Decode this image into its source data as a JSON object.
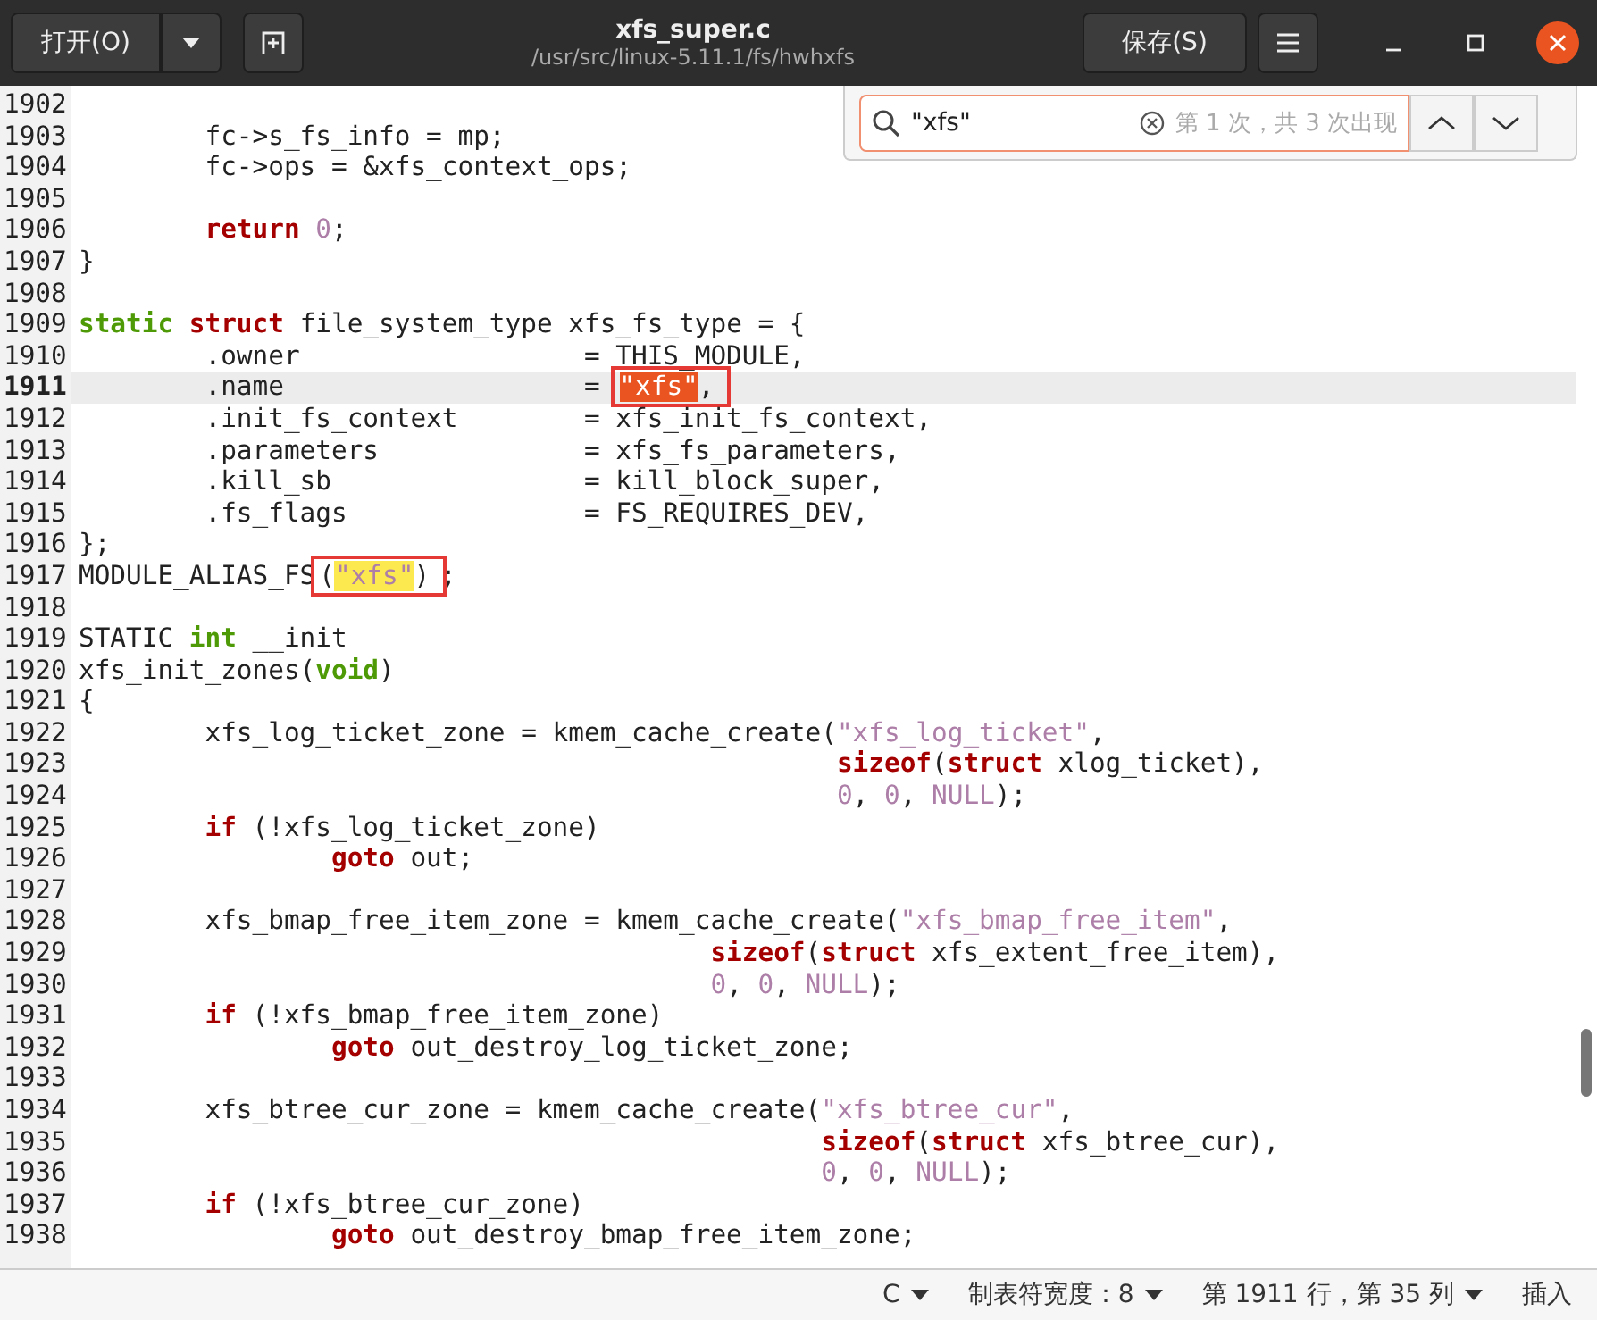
{
  "header": {
    "open_button": "打开(O)",
    "title": "xfs_super.c",
    "subtitle": "/usr/src/linux-5.11.1/fs/hwhxfs",
    "save_button": "保存(S)"
  },
  "search": {
    "value": "\"xfs\"",
    "result": "第 1 次，共 3 次出现"
  },
  "editor": {
    "lines": [
      {
        "number": "1902",
        "current": false
      },
      {
        "number": "1903",
        "current": false,
        "parts": [
          {
            "text": "        fc->s_fs_info = mp;",
            "kind": "plain"
          }
        ]
      },
      {
        "number": "1904",
        "current": false,
        "parts": [
          {
            "text": "        fc->ops = &xfs_context_ops;",
            "kind": "plain"
          }
        ]
      },
      {
        "number": "1905",
        "current": false
      },
      {
        "number": "1906",
        "current": false,
        "parts": [
          {
            "text": "        return",
            "kind": "keyword"
          },
          {
            "text": " 0",
            "kind": "number"
          },
          {
            "text": ";",
            "kind": "plain"
          }
        ]
      },
      {
        "number": "1907",
        "current": false,
        "parts": [
          {
            "text": "}",
            "kind": "plain"
          }
        ]
      },
      {
        "number": "1908",
        "current": false
      },
      {
        "number": "1909",
        "current": false,
        "parts": [
          {
            "text": "static",
            "kind": "type"
          },
          {
            "text": " struct",
            "kind": "keyword"
          },
          {
            "text": " file_system_type xfs_fs_type = {",
            "kind": "plain"
          }
        ]
      },
      {
        "number": "1910",
        "current": false,
        "parts": [
          {
            "text": "        .owner                  = THIS_MODULE,",
            "kind": "plain"
          }
        ]
      },
      {
        "number": "1911",
        "current": true,
        "parts": [
          {
            "text": "        .name                   = ",
            "kind": "plain"
          },
          {
            "boxed": true,
            "parts": [
              {
                "text": "\"xfs\"",
                "kind": "match",
                "current": true
              },
              {
                "text": ",",
                "kind": "plain"
              }
            ]
          }
        ]
      },
      {
        "number": "1912",
        "current": false,
        "parts": [
          {
            "text": "        .init_fs_context        = xfs_init_fs_context,",
            "kind": "plain"
          }
        ]
      },
      {
        "number": "1913",
        "current": false,
        "parts": [
          {
            "text": "        .parameters             = xfs_fs_parameters,",
            "kind": "plain"
          }
        ]
      },
      {
        "number": "1914",
        "current": false,
        "parts": [
          {
            "text": "        .kill_sb                = kill_block_super,",
            "kind": "plain"
          }
        ]
      },
      {
        "number": "1915",
        "current": false,
        "parts": [
          {
            "text": "        .fs_flags               = FS_REQUIRES_DEV,",
            "kind": "plain"
          }
        ]
      },
      {
        "number": "1916",
        "current": false,
        "parts": [
          {
            "text": "};",
            "kind": "plain"
          }
        ]
      },
      {
        "number": "1917",
        "current": false,
        "parts": [
          {
            "text": "MODULE_ALIAS_FS",
            "kind": "plain"
          },
          {
            "boxed": true,
            "parts": [
              {
                "text": "(",
                "kind": "plain"
              },
              {
                "text": "\"xfs\"",
                "kind": "match",
                "current": false
              },
              {
                "text": ")",
                "kind": "plain"
              }
            ]
          },
          {
            "text": ";",
            "kind": "plain"
          }
        ]
      },
      {
        "number": "1918",
        "current": false
      },
      {
        "number": "1919",
        "current": false,
        "parts": [
          {
            "text": "STATIC ",
            "kind": "plain"
          },
          {
            "text": "int",
            "kind": "type"
          },
          {
            "text": " __init",
            "kind": "plain"
          }
        ]
      },
      {
        "number": "1920",
        "current": false,
        "parts": [
          {
            "text": "xfs_init_zones(",
            "kind": "plain"
          },
          {
            "text": "void",
            "kind": "type"
          },
          {
            "text": ")",
            "kind": "plain"
          }
        ]
      },
      {
        "number": "1921",
        "current": false,
        "parts": [
          {
            "text": "{",
            "kind": "plain"
          }
        ]
      },
      {
        "number": "1922",
        "current": false,
        "parts": [
          {
            "text": "        xfs_log_ticket_zone = kmem_cache_create(",
            "kind": "plain"
          },
          {
            "text": "\"xfs_log_ticket\"",
            "kind": "string"
          },
          {
            "text": ",",
            "kind": "plain"
          }
        ]
      },
      {
        "number": "1923",
        "current": false,
        "parts": [
          {
            "text": "                                                sizeof",
            "kind": "keyword"
          },
          {
            "text": "(",
            "kind": "plain"
          },
          {
            "text": "struct",
            "kind": "keyword"
          },
          {
            "text": " xlog_ticket),",
            "kind": "plain"
          }
        ]
      },
      {
        "number": "1924",
        "current": false,
        "parts": [
          {
            "text": "                                                0",
            "kind": "number"
          },
          {
            "text": ", ",
            "kind": "plain"
          },
          {
            "text": "0",
            "kind": "number"
          },
          {
            "text": ", ",
            "kind": "plain"
          },
          {
            "text": "NULL",
            "kind": "number"
          },
          {
            "text": ");",
            "kind": "plain"
          }
        ]
      },
      {
        "number": "1925",
        "current": false,
        "parts": [
          {
            "text": "        if",
            "kind": "keyword"
          },
          {
            "text": " (!xfs_log_ticket_zone)",
            "kind": "plain"
          }
        ]
      },
      {
        "number": "1926",
        "current": false,
        "parts": [
          {
            "text": "                goto",
            "kind": "keyword"
          },
          {
            "text": " out;",
            "kind": "plain"
          }
        ]
      },
      {
        "number": "1927",
        "current": false
      },
      {
        "number": "1928",
        "current": false,
        "parts": [
          {
            "text": "        xfs_bmap_free_item_zone = kmem_cache_create(",
            "kind": "plain"
          },
          {
            "text": "\"xfs_bmap_free_item\"",
            "kind": "string"
          },
          {
            "text": ",",
            "kind": "plain"
          }
        ]
      },
      {
        "number": "1929",
        "current": false,
        "parts": [
          {
            "text": "                                        sizeof",
            "kind": "keyword"
          },
          {
            "text": "(",
            "kind": "plain"
          },
          {
            "text": "struct",
            "kind": "keyword"
          },
          {
            "text": " xfs_extent_free_item),",
            "kind": "plain"
          }
        ]
      },
      {
        "number": "1930",
        "current": false,
        "parts": [
          {
            "text": "                                        0",
            "kind": "number"
          },
          {
            "text": ", ",
            "kind": "plain"
          },
          {
            "text": "0",
            "kind": "number"
          },
          {
            "text": ", ",
            "kind": "plain"
          },
          {
            "text": "NULL",
            "kind": "number"
          },
          {
            "text": ");",
            "kind": "plain"
          }
        ]
      },
      {
        "number": "1931",
        "current": false,
        "parts": [
          {
            "text": "        if",
            "kind": "keyword"
          },
          {
            "text": " (!xfs_bmap_free_item_zone)",
            "kind": "plain"
          }
        ]
      },
      {
        "number": "1932",
        "current": false,
        "parts": [
          {
            "text": "                goto",
            "kind": "keyword"
          },
          {
            "text": " out_destroy_log_ticket_zone;",
            "kind": "plain"
          }
        ]
      },
      {
        "number": "1933",
        "current": false
      },
      {
        "number": "1934",
        "current": false,
        "parts": [
          {
            "text": "        xfs_btree_cur_zone = kmem_cache_create(",
            "kind": "plain"
          },
          {
            "text": "\"xfs_btree_cur\"",
            "kind": "string"
          },
          {
            "text": ",",
            "kind": "plain"
          }
        ]
      },
      {
        "number": "1935",
        "current": false,
        "parts": [
          {
            "text": "                                               sizeof",
            "kind": "keyword"
          },
          {
            "text": "(",
            "kind": "plain"
          },
          {
            "text": "struct",
            "kind": "keyword"
          },
          {
            "text": " xfs_btree_cur),",
            "kind": "plain"
          }
        ]
      },
      {
        "number": "1936",
        "current": false,
        "parts": [
          {
            "text": "                                               0",
            "kind": "number"
          },
          {
            "text": ", ",
            "kind": "plain"
          },
          {
            "text": "0",
            "kind": "number"
          },
          {
            "text": ", ",
            "kind": "plain"
          },
          {
            "text": "NULL",
            "kind": "number"
          },
          {
            "text": ");",
            "kind": "plain"
          }
        ]
      },
      {
        "number": "1937",
        "current": false,
        "parts": [
          {
            "text": "        if",
            "kind": "keyword"
          },
          {
            "text": " (!xfs_btree_cur_zone)",
            "kind": "plain"
          }
        ]
      },
      {
        "number": "1938",
        "current": false,
        "parts": [
          {
            "text": "                goto",
            "kind": "keyword"
          },
          {
            "text": " out_destroy_bmap_free_item_zone;",
            "kind": "plain"
          }
        ]
      }
    ]
  },
  "status_bar": {
    "language": "C",
    "tab_width": "制表符宽度：8",
    "position": "第 1911 行，第 35 列",
    "mode": "插入"
  }
}
